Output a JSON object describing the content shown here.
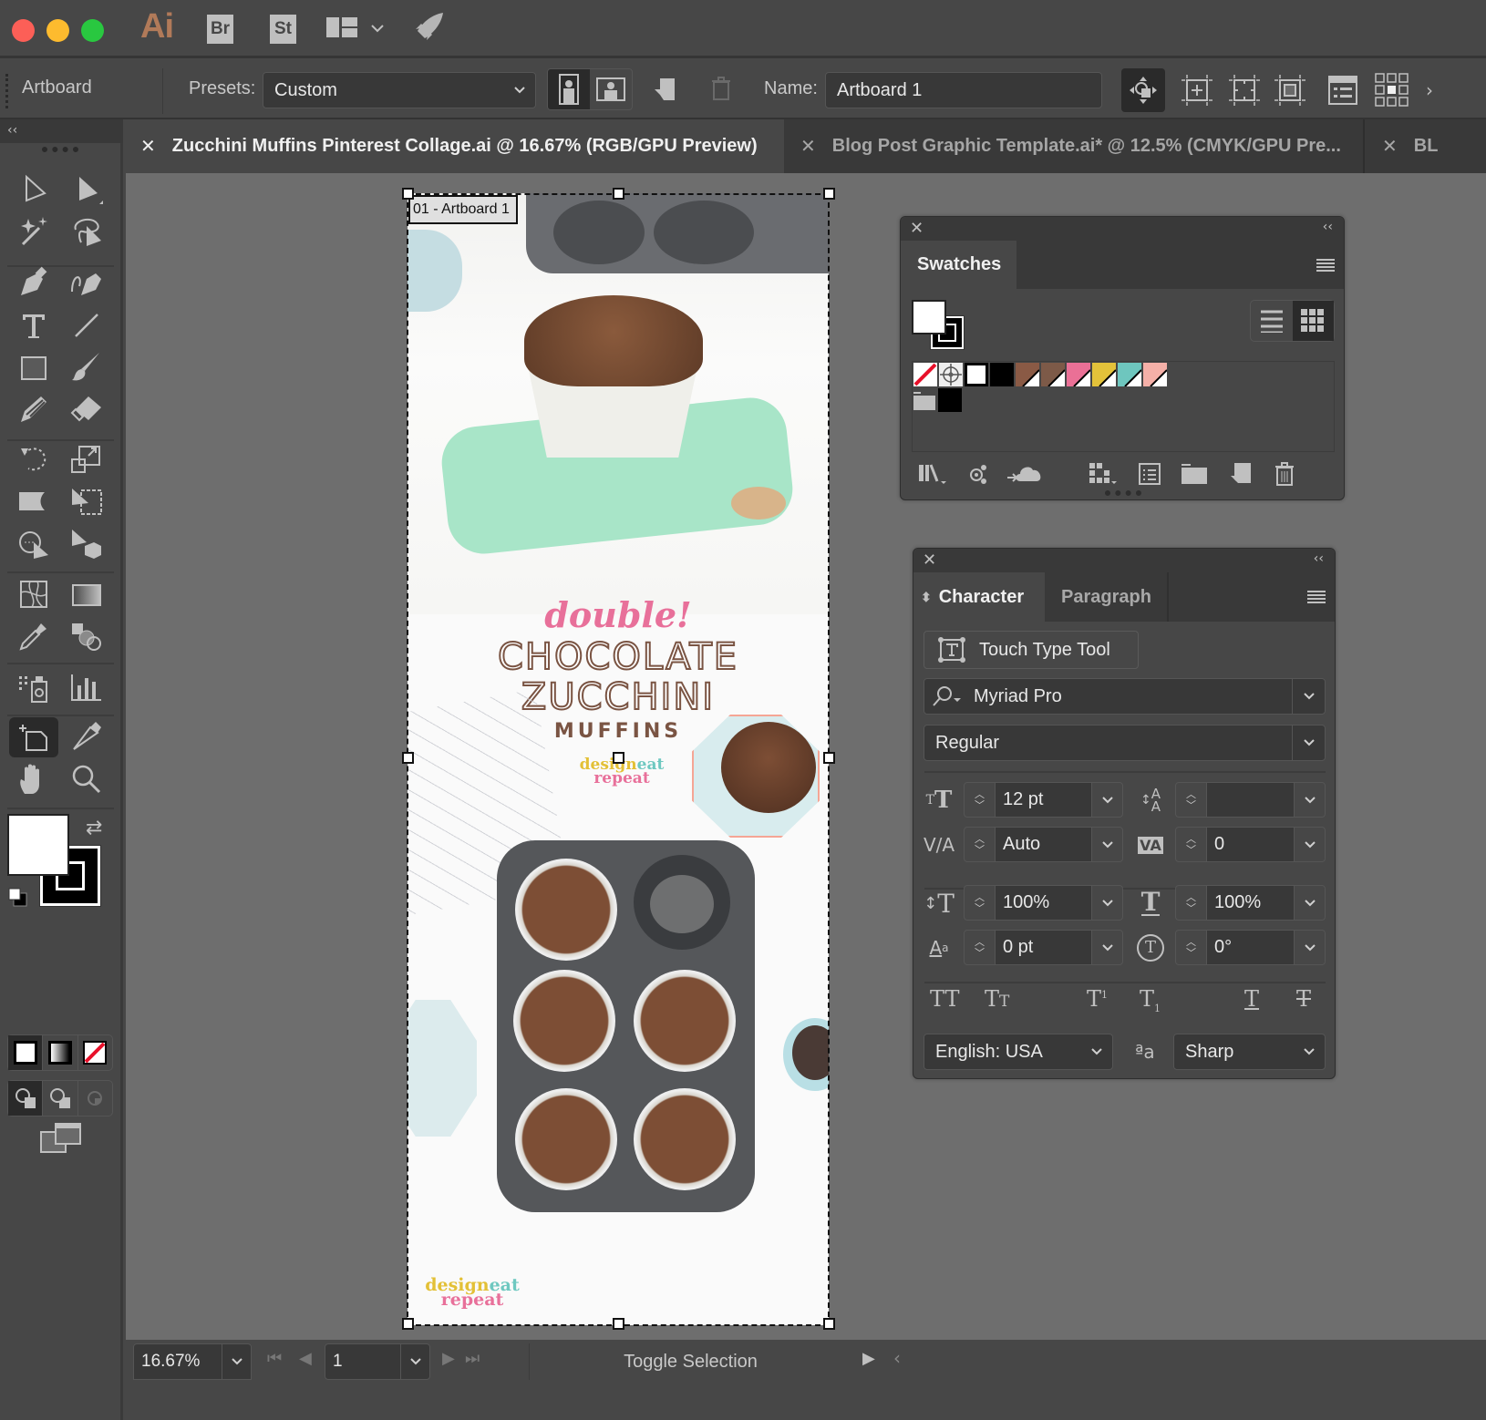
{
  "app": {
    "logo": "Ai",
    "bridge": "Br",
    "stock": "St",
    "icons": [
      "workspace-switcher-icon",
      "chevron-down-icon",
      "rocket-icon"
    ]
  },
  "control_bar": {
    "mode_label": "Artboard",
    "presets_label": "Presets:",
    "presets_value": "Custom",
    "name_label": "Name:",
    "name_value": "Artboard 1"
  },
  "tabs": [
    {
      "label": "Zucchini Muffins Pinterest Collage.ai @ 16.67% (RGB/GPU Preview)",
      "active": true
    },
    {
      "label": "Blog Post Graphic Template.ai* @ 12.5% (CMYK/GPU Pre...",
      "active": false
    },
    {
      "label": "BL",
      "active": false
    }
  ],
  "artboard": {
    "label": "01 - Artboard 1",
    "headline_script": "double!",
    "headline_1": "CHOCOLATE",
    "headline_2": "ZUCCHINI",
    "headline_3": "MUFFINS",
    "logo_line1a": "design",
    "logo_line1b": "eat",
    "logo_line2": "repeat",
    "colors": {
      "pink": "#e8709a",
      "brown": "#7a5443",
      "yellow": "#e3c036",
      "teal": "#6ec8c0"
    }
  },
  "swatches_panel": {
    "tab": "Swatches",
    "swatches": [
      {
        "name": "None",
        "color": "none"
      },
      {
        "name": "Registration",
        "color": "registration"
      },
      {
        "name": "White",
        "color": "#ffffff"
      },
      {
        "name": "Black",
        "color": "#000000"
      },
      {
        "name": "Brown 1",
        "color": "#8a5a45"
      },
      {
        "name": "Brown 2",
        "color": "#7d5a48"
      },
      {
        "name": "Pink",
        "color": "#ea7096"
      },
      {
        "name": "Yellow",
        "color": "#e3c23a"
      },
      {
        "name": "Teal",
        "color": "#6ec6be"
      },
      {
        "name": "Peach",
        "color": "#f5b0a8"
      }
    ],
    "group_swatches": [
      {
        "name": "Black",
        "color": "#000000"
      }
    ]
  },
  "character_panel": {
    "tab_active": "Character",
    "tab_inactive": "Paragraph",
    "touch_type": "Touch Type Tool",
    "font_family": "Myriad Pro",
    "font_style": "Regular",
    "font_size": "12 pt",
    "leading": "",
    "kerning": "Auto",
    "tracking": "0",
    "vertical_scale": "100%",
    "horizontal_scale": "100%",
    "baseline_shift": "0 pt",
    "rotation": "0°",
    "language": "English: USA",
    "antialias_icon": "ªa",
    "antialias": "Sharp"
  },
  "status_bar": {
    "zoom": "16.67%",
    "artboard_num": "1",
    "status_text": "Toggle Selection"
  }
}
